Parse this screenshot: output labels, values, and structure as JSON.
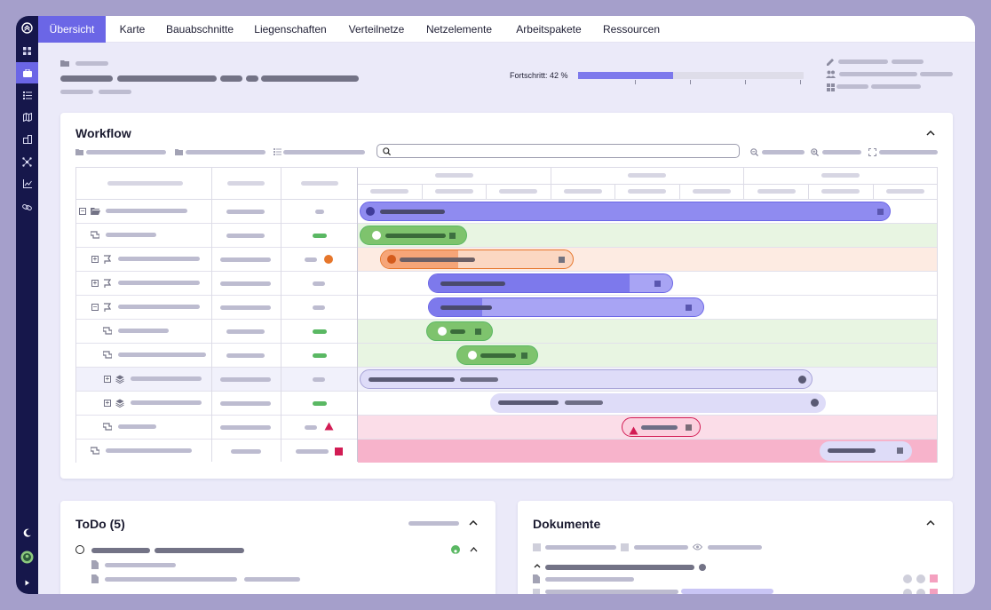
{
  "nav": {
    "tabs": [
      {
        "label": "Übersicht",
        "active": true
      },
      {
        "label": "Karte"
      },
      {
        "label": "Bauabschnitte"
      },
      {
        "label": "Liegenschaften"
      },
      {
        "label": "Verteilnetze"
      },
      {
        "label": "Netzelemente"
      },
      {
        "label": "Arbeitspakete"
      },
      {
        "label": "Ressourcen"
      }
    ]
  },
  "rail": {
    "items": [
      "grid-icon",
      "briefcase-icon",
      "list-icon",
      "map-icon",
      "buildings-icon",
      "network-icon",
      "chart-icon",
      "link-icon"
    ],
    "bottom": [
      "moon-icon",
      "avatar-icon",
      "expand-icon"
    ]
  },
  "header": {
    "progress_label": "Fortschritt: 42 %",
    "progress_fraction": 0.42
  },
  "workflow": {
    "title": "Workflow",
    "rows": [
      {
        "status": "gray",
        "bar": {
          "color": "violet",
          "progress": 1.0
        }
      },
      {
        "status": "green",
        "bar": {
          "color": "green"
        }
      },
      {
        "status": "orange",
        "bar": {
          "color": "orange",
          "progress": 0.4
        }
      },
      {
        "status": "gray",
        "bar": {
          "color": "violet",
          "progress": 0.82
        }
      },
      {
        "status": "gray",
        "bar": {
          "color": "violet",
          "progress": 0.2
        }
      },
      {
        "status": "green",
        "bar": {
          "color": "green"
        }
      },
      {
        "status": "green",
        "bar": {
          "color": "green"
        }
      },
      {
        "status": "gray",
        "bar": {
          "color": "lavender"
        }
      },
      {
        "status": "green",
        "bar": {
          "color": "lavender"
        }
      },
      {
        "status": "red-triangle",
        "bar": {
          "color": "pink"
        }
      },
      {
        "status": "red-square",
        "bar": {
          "color": "lightgray"
        }
      }
    ]
  },
  "todo": {
    "title": "ToDo (5)"
  },
  "dokumente": {
    "title": "Dokumente"
  },
  "colors": {
    "accent": "#6b66e6",
    "rail": "#16174b",
    "green": "#5ab863",
    "orange": "#e6762b",
    "red": "#d21c54"
  }
}
